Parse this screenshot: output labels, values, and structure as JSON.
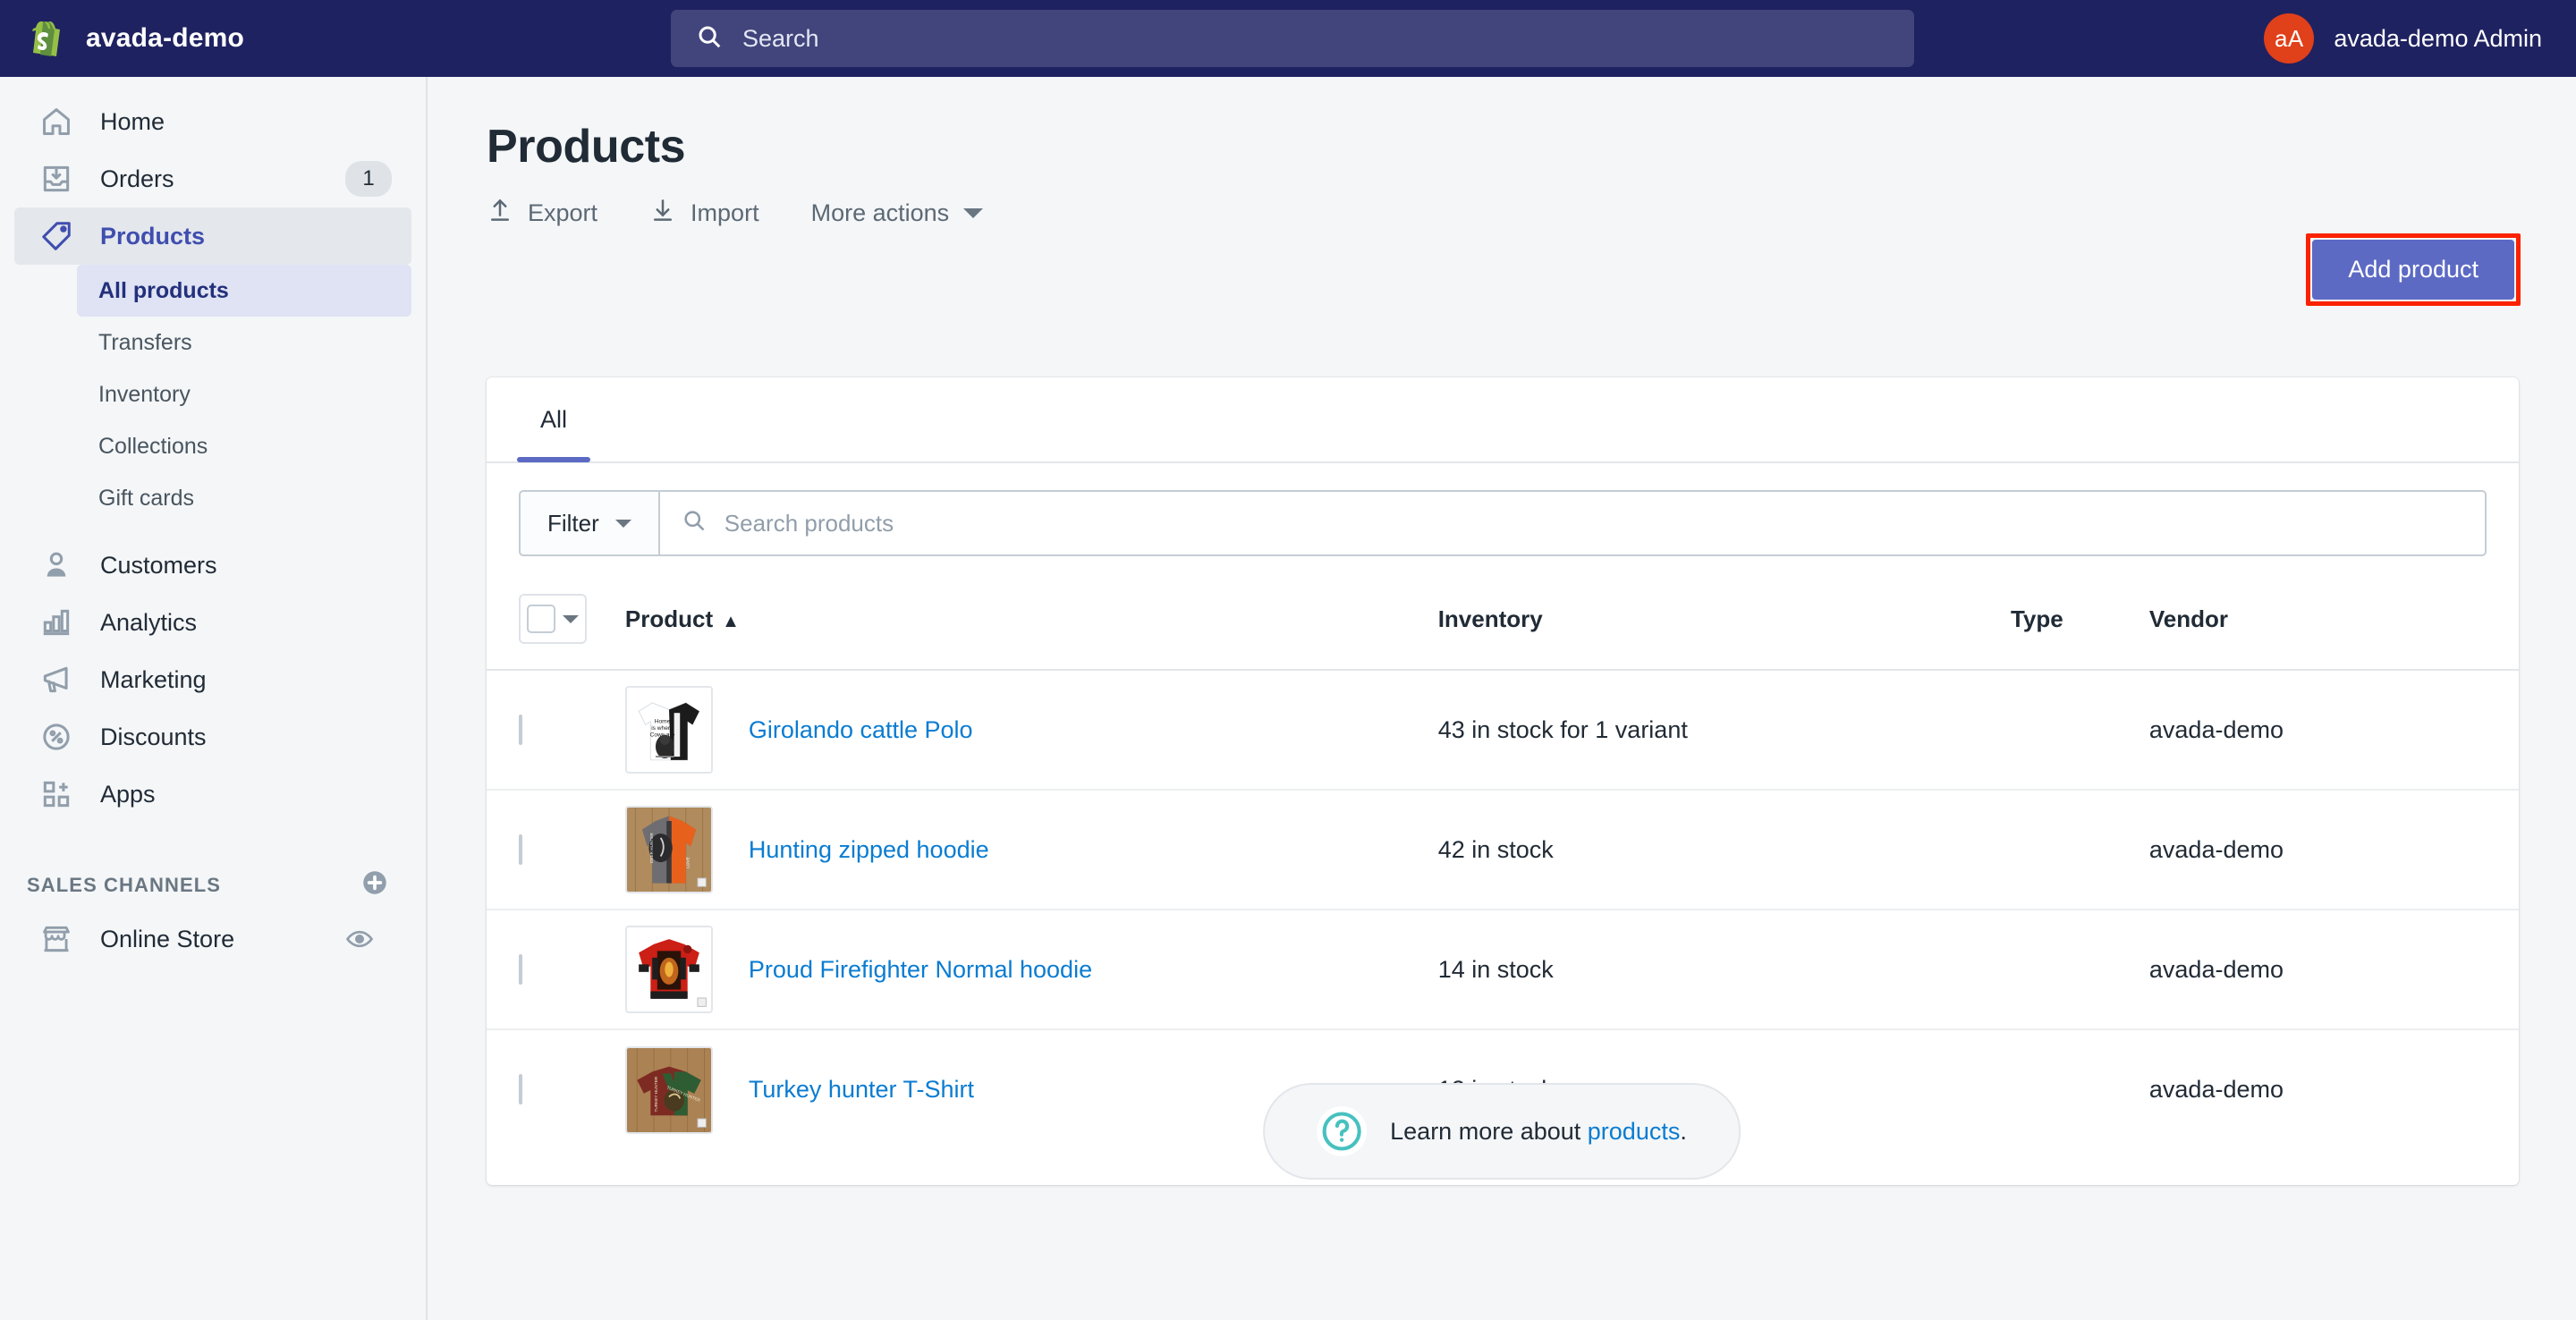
{
  "topbar": {
    "shop_name": "avada-demo",
    "search_placeholder": "Search",
    "avatar_initials": "aA",
    "user_name": "avada-demo Admin",
    "bg_color": "#1f2260"
  },
  "sidebar": {
    "items": [
      {
        "label": "Home",
        "icon": "home-icon",
        "badge": ""
      },
      {
        "label": "Orders",
        "icon": "orders-icon",
        "badge": "1"
      },
      {
        "label": "Products",
        "icon": "products-tag-icon",
        "badge": ""
      },
      {
        "label": "Customers",
        "icon": "customers-icon",
        "badge": ""
      },
      {
        "label": "Analytics",
        "icon": "analytics-icon",
        "badge": ""
      },
      {
        "label": "Marketing",
        "icon": "marketing-megaphone-icon",
        "badge": ""
      },
      {
        "label": "Discounts",
        "icon": "discounts-icon",
        "badge": ""
      },
      {
        "label": "Apps",
        "icon": "apps-icon",
        "badge": ""
      }
    ],
    "sub_items": [
      {
        "label": "All products",
        "selected": true
      },
      {
        "label": "Transfers",
        "selected": false
      },
      {
        "label": "Inventory",
        "selected": false
      },
      {
        "label": "Collections",
        "selected": false
      },
      {
        "label": "Gift cards",
        "selected": false
      }
    ],
    "sales_channels": {
      "title": "SALES CHANNELS",
      "add_icon": "plus-circle-icon",
      "channels": [
        {
          "label": "Online Store",
          "icon": "store-icon",
          "action_icon": "eye-icon"
        }
      ]
    },
    "active_item": "Products",
    "active_color": "#3f4eae"
  },
  "main": {
    "page_title": "Products",
    "actions": [
      {
        "label": "Export",
        "icon": "export-upload-icon"
      },
      {
        "label": "Import",
        "icon": "import-download-icon"
      },
      {
        "label": "More actions",
        "icon": "chevron-down-icon"
      }
    ],
    "add_product_label": "Add product",
    "add_product_color": "#5c6ac4",
    "highlight_color": "#fb2200",
    "tabs": [
      {
        "label": "All",
        "active": true
      }
    ],
    "filter_label": "Filter",
    "search_products_placeholder": "Search products",
    "table": {
      "headers": {
        "product": "Product",
        "inventory": "Inventory",
        "type": "Type",
        "vendor": "Vendor"
      },
      "sort_column": "Product",
      "sort_direction": "ascending",
      "rows": [
        {
          "name": "Girolando cattle Polo",
          "inventory": "43 in stock for 1 variant",
          "type": "",
          "vendor": "avada-demo",
          "thumb": "black-white-cow-polo-shirt"
        },
        {
          "name": "Hunting zipped hoodie",
          "inventory": "42 in stock",
          "type": "",
          "vendor": "avada-demo",
          "thumb": "orange-grey-hunting-hoodie"
        },
        {
          "name": "Proud Firefighter Normal hoodie",
          "inventory": "14 in stock",
          "type": "",
          "vendor": "avada-demo",
          "thumb": "red-firefighter-jacket"
        },
        {
          "name": "Turkey hunter T-Shirt",
          "inventory": "12 in stock",
          "type": "",
          "vendor": "avada-demo",
          "thumb": "maroon-green-turkey-tshirt"
        }
      ]
    },
    "footer_help": {
      "icon": "question-mark-circle-icon",
      "text_prefix": "Learn more about ",
      "link": "products",
      "text_suffix": "."
    }
  }
}
